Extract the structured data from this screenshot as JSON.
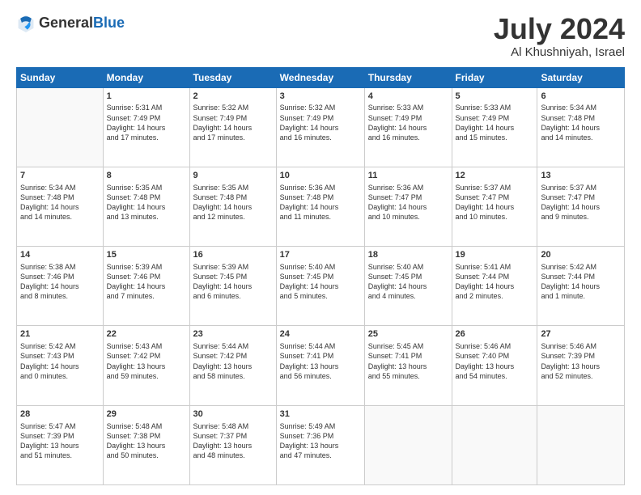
{
  "header": {
    "logo_general": "General",
    "logo_blue": "Blue",
    "month": "July 2024",
    "location": "Al Khushniyah, Israel"
  },
  "weekdays": [
    "Sunday",
    "Monday",
    "Tuesday",
    "Wednesday",
    "Thursday",
    "Friday",
    "Saturday"
  ],
  "weeks": [
    [
      {
        "day": "",
        "info": ""
      },
      {
        "day": "1",
        "info": "Sunrise: 5:31 AM\nSunset: 7:49 PM\nDaylight: 14 hours\nand 17 minutes."
      },
      {
        "day": "2",
        "info": "Sunrise: 5:32 AM\nSunset: 7:49 PM\nDaylight: 14 hours\nand 17 minutes."
      },
      {
        "day": "3",
        "info": "Sunrise: 5:32 AM\nSunset: 7:49 PM\nDaylight: 14 hours\nand 16 minutes."
      },
      {
        "day": "4",
        "info": "Sunrise: 5:33 AM\nSunset: 7:49 PM\nDaylight: 14 hours\nand 16 minutes."
      },
      {
        "day": "5",
        "info": "Sunrise: 5:33 AM\nSunset: 7:49 PM\nDaylight: 14 hours\nand 15 minutes."
      },
      {
        "day": "6",
        "info": "Sunrise: 5:34 AM\nSunset: 7:48 PM\nDaylight: 14 hours\nand 14 minutes."
      }
    ],
    [
      {
        "day": "7",
        "info": "Sunrise: 5:34 AM\nSunset: 7:48 PM\nDaylight: 14 hours\nand 14 minutes."
      },
      {
        "day": "8",
        "info": "Sunrise: 5:35 AM\nSunset: 7:48 PM\nDaylight: 14 hours\nand 13 minutes."
      },
      {
        "day": "9",
        "info": "Sunrise: 5:35 AM\nSunset: 7:48 PM\nDaylight: 14 hours\nand 12 minutes."
      },
      {
        "day": "10",
        "info": "Sunrise: 5:36 AM\nSunset: 7:48 PM\nDaylight: 14 hours\nand 11 minutes."
      },
      {
        "day": "11",
        "info": "Sunrise: 5:36 AM\nSunset: 7:47 PM\nDaylight: 14 hours\nand 10 minutes."
      },
      {
        "day": "12",
        "info": "Sunrise: 5:37 AM\nSunset: 7:47 PM\nDaylight: 14 hours\nand 10 minutes."
      },
      {
        "day": "13",
        "info": "Sunrise: 5:37 AM\nSunset: 7:47 PM\nDaylight: 14 hours\nand 9 minutes."
      }
    ],
    [
      {
        "day": "14",
        "info": "Sunrise: 5:38 AM\nSunset: 7:46 PM\nDaylight: 14 hours\nand 8 minutes."
      },
      {
        "day": "15",
        "info": "Sunrise: 5:39 AM\nSunset: 7:46 PM\nDaylight: 14 hours\nand 7 minutes."
      },
      {
        "day": "16",
        "info": "Sunrise: 5:39 AM\nSunset: 7:45 PM\nDaylight: 14 hours\nand 6 minutes."
      },
      {
        "day": "17",
        "info": "Sunrise: 5:40 AM\nSunset: 7:45 PM\nDaylight: 14 hours\nand 5 minutes."
      },
      {
        "day": "18",
        "info": "Sunrise: 5:40 AM\nSunset: 7:45 PM\nDaylight: 14 hours\nand 4 minutes."
      },
      {
        "day": "19",
        "info": "Sunrise: 5:41 AM\nSunset: 7:44 PM\nDaylight: 14 hours\nand 2 minutes."
      },
      {
        "day": "20",
        "info": "Sunrise: 5:42 AM\nSunset: 7:44 PM\nDaylight: 14 hours\nand 1 minute."
      }
    ],
    [
      {
        "day": "21",
        "info": "Sunrise: 5:42 AM\nSunset: 7:43 PM\nDaylight: 14 hours\nand 0 minutes."
      },
      {
        "day": "22",
        "info": "Sunrise: 5:43 AM\nSunset: 7:42 PM\nDaylight: 13 hours\nand 59 minutes."
      },
      {
        "day": "23",
        "info": "Sunrise: 5:44 AM\nSunset: 7:42 PM\nDaylight: 13 hours\nand 58 minutes."
      },
      {
        "day": "24",
        "info": "Sunrise: 5:44 AM\nSunset: 7:41 PM\nDaylight: 13 hours\nand 56 minutes."
      },
      {
        "day": "25",
        "info": "Sunrise: 5:45 AM\nSunset: 7:41 PM\nDaylight: 13 hours\nand 55 minutes."
      },
      {
        "day": "26",
        "info": "Sunrise: 5:46 AM\nSunset: 7:40 PM\nDaylight: 13 hours\nand 54 minutes."
      },
      {
        "day": "27",
        "info": "Sunrise: 5:46 AM\nSunset: 7:39 PM\nDaylight: 13 hours\nand 52 minutes."
      }
    ],
    [
      {
        "day": "28",
        "info": "Sunrise: 5:47 AM\nSunset: 7:39 PM\nDaylight: 13 hours\nand 51 minutes."
      },
      {
        "day": "29",
        "info": "Sunrise: 5:48 AM\nSunset: 7:38 PM\nDaylight: 13 hours\nand 50 minutes."
      },
      {
        "day": "30",
        "info": "Sunrise: 5:48 AM\nSunset: 7:37 PM\nDaylight: 13 hours\nand 48 minutes."
      },
      {
        "day": "31",
        "info": "Sunrise: 5:49 AM\nSunset: 7:36 PM\nDaylight: 13 hours\nand 47 minutes."
      },
      {
        "day": "",
        "info": ""
      },
      {
        "day": "",
        "info": ""
      },
      {
        "day": "",
        "info": ""
      }
    ]
  ]
}
